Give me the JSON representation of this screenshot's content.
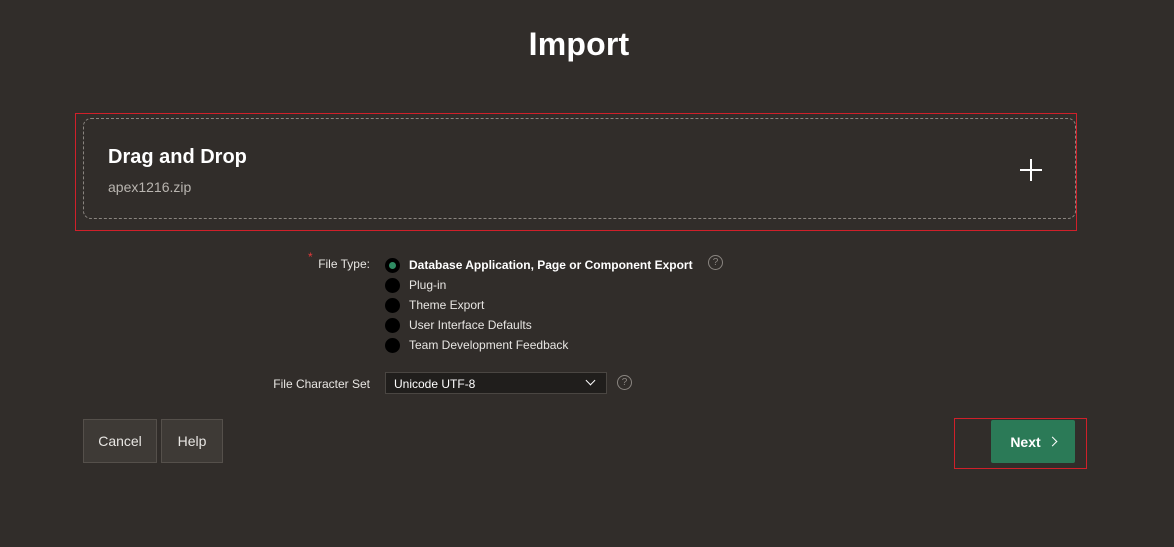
{
  "page": {
    "title": "Import"
  },
  "dropzone": {
    "title": "Drag and Drop",
    "file_name": "apex1216.zip",
    "icon": "plus-icon"
  },
  "file_type": {
    "label": "File Type:",
    "required_marker": "*",
    "selected": "Database Application, Page or Component Export",
    "options": [
      "Database Application, Page or Component Export",
      "Plug-in",
      "Theme Export",
      "User Interface Defaults",
      "Team Development Feedback"
    ],
    "help_glyph": "?"
  },
  "char_set": {
    "label": "File Character Set",
    "value": "Unicode UTF-8",
    "help_glyph": "?"
  },
  "buttons": {
    "cancel": "Cancel",
    "help": "Help",
    "next": "Next"
  },
  "colors": {
    "background": "#312d2a",
    "primary": "#2b7a57",
    "selected_radio": "#2f8c63",
    "highlight": "#d0202a",
    "required": "#e03a3a"
  }
}
